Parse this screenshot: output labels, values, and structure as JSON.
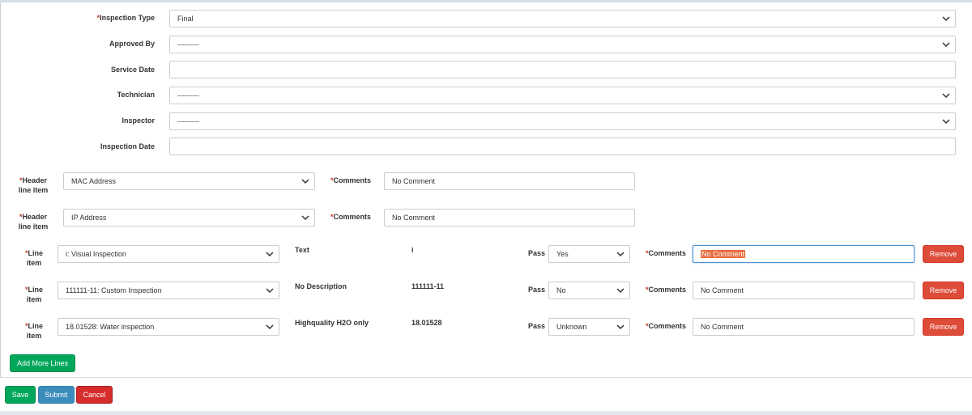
{
  "required_mark": "*",
  "form": {
    "inspection_type": {
      "label": "Inspection Type",
      "value": "Final"
    },
    "approved_by": {
      "label": "Approved By",
      "value": "---------"
    },
    "service_date": {
      "label": "Service Date",
      "value": ""
    },
    "technician": {
      "label": "Technician",
      "value": "---------"
    },
    "inspector": {
      "label": "Inspector",
      "value": "---------"
    },
    "inspection_date": {
      "label": "Inspection Date",
      "value": ""
    }
  },
  "header_lines": [
    {
      "label_line1": "Header",
      "label_line2": "line item",
      "value": "MAC Address",
      "comments_label": "Comments",
      "comment": "No Comment"
    },
    {
      "label_line1": "Header",
      "label_line2": "line item",
      "value": "IP Address",
      "comments_label": "Comments",
      "comment": "No Comment"
    }
  ],
  "line_items": [
    {
      "label_line1": "Line",
      "label_line2": "item",
      "value": "i: Visual Inspection",
      "description": "Text",
      "code": "i",
      "pass_label": "Pass",
      "pass": "Yes",
      "comments_label": "Comments",
      "comment": "No Comment",
      "remove": "Remove"
    },
    {
      "label_line1": "Line",
      "label_line2": "item",
      "value": "111111-11: Custom Inspection",
      "description": "No Description",
      "code": "111111-11",
      "pass_label": "Pass",
      "pass": "No",
      "comments_label": "Comments",
      "comment": "No Comment",
      "remove": "Remove"
    },
    {
      "label_line1": "Line",
      "label_line2": "item",
      "value": "18.01528: Water inspection",
      "description": "Highquality H2O only",
      "code": "18.01528",
      "pass_label": "Pass",
      "pass": "Unknown",
      "comments_label": "Comments",
      "comment": "No Comment",
      "remove": "Remove"
    }
  ],
  "add_more_lines": "Add More Lines",
  "footer": {
    "save": "Save",
    "submit": "Submit",
    "cancel": "Cancel"
  },
  "colors": {
    "danger": "#dd4b39",
    "success": "#00a65a",
    "primary": "#3c8dbc",
    "cancel": "#d62c2c",
    "required": "#c0392b"
  },
  "icons": {
    "select_arrow": "chevron-down-icon"
  }
}
